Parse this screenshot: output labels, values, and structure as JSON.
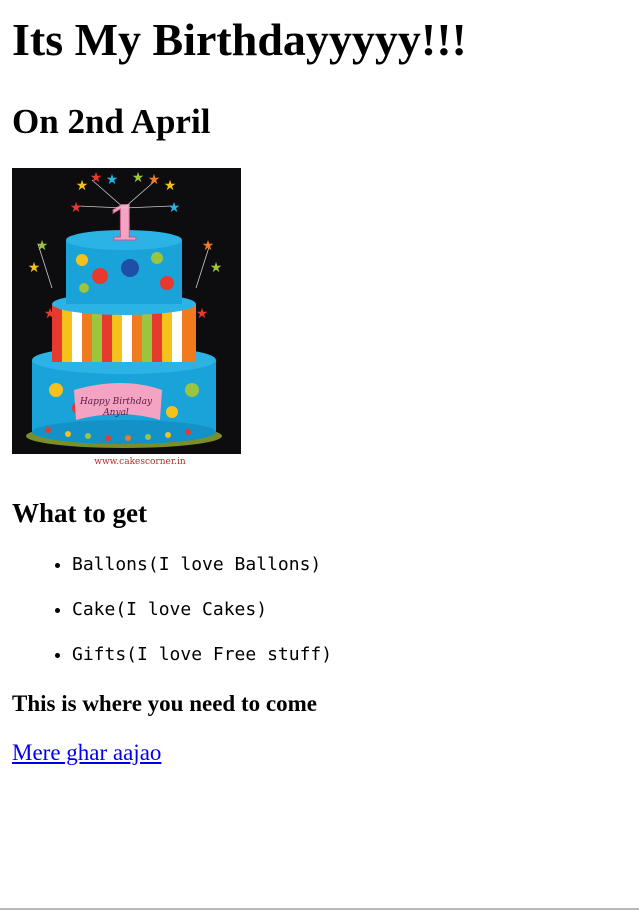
{
  "page": {
    "title": "Its My Birthdayyyyy!!!",
    "date_heading": "On 2nd April"
  },
  "cake_image": {
    "alt": "Three-tier birthday cake",
    "topper_number": "1",
    "plaque_line1": "Happy Birthday",
    "plaque_line2": "Anyal",
    "watermark": "www.cakescorner.in"
  },
  "wishlist": {
    "heading": "What to get",
    "items": [
      "Ballons(I love Ballons)",
      "Cake(I love Cakes)",
      "Gifts(I love Free stuff)"
    ]
  },
  "location": {
    "heading": "This is where you need to come",
    "link_text": "Mere ghar aajao"
  },
  "colors": {
    "link": "#0000ee",
    "cake_blue": "#1aa3d9"
  }
}
